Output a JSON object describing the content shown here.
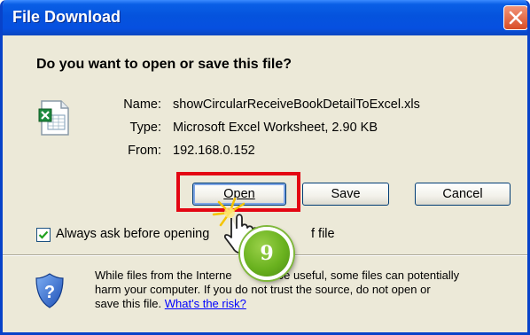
{
  "dialog": {
    "title": "File Download",
    "question": "Do you want to open or save this file?",
    "file": {
      "icon": "excel-file-icon",
      "name_label": "Name:",
      "name": "showCircularReceiveBookDetailToExcel.xls",
      "type_label": "Type:",
      "type": "Microsoft Excel Worksheet, 2.90 KB",
      "from_label": "From:",
      "from": "192.168.0.152"
    },
    "buttons": {
      "open": "Open",
      "save": "Save",
      "cancel": "Cancel"
    },
    "always_ask": {
      "label": "Always ask before opening",
      "label_tail": "f file",
      "checked": true
    },
    "warning": {
      "icon": "shield-question-icon",
      "line1": "While files from the Interne",
      "line1b": "be useful, some files can potentially",
      "line2": "harm your computer. If you do not trust the source, do not open or",
      "line3": "save this file.",
      "link": "What's the risk?"
    }
  },
  "annotation": {
    "step_number": "9",
    "highlight_color": "#e30613",
    "badge_color": "#6ab21f"
  },
  "colors": {
    "title_bar": "#0553dd",
    "dialog_bg": "#ece9d8",
    "close_button": "#d94d26"
  }
}
